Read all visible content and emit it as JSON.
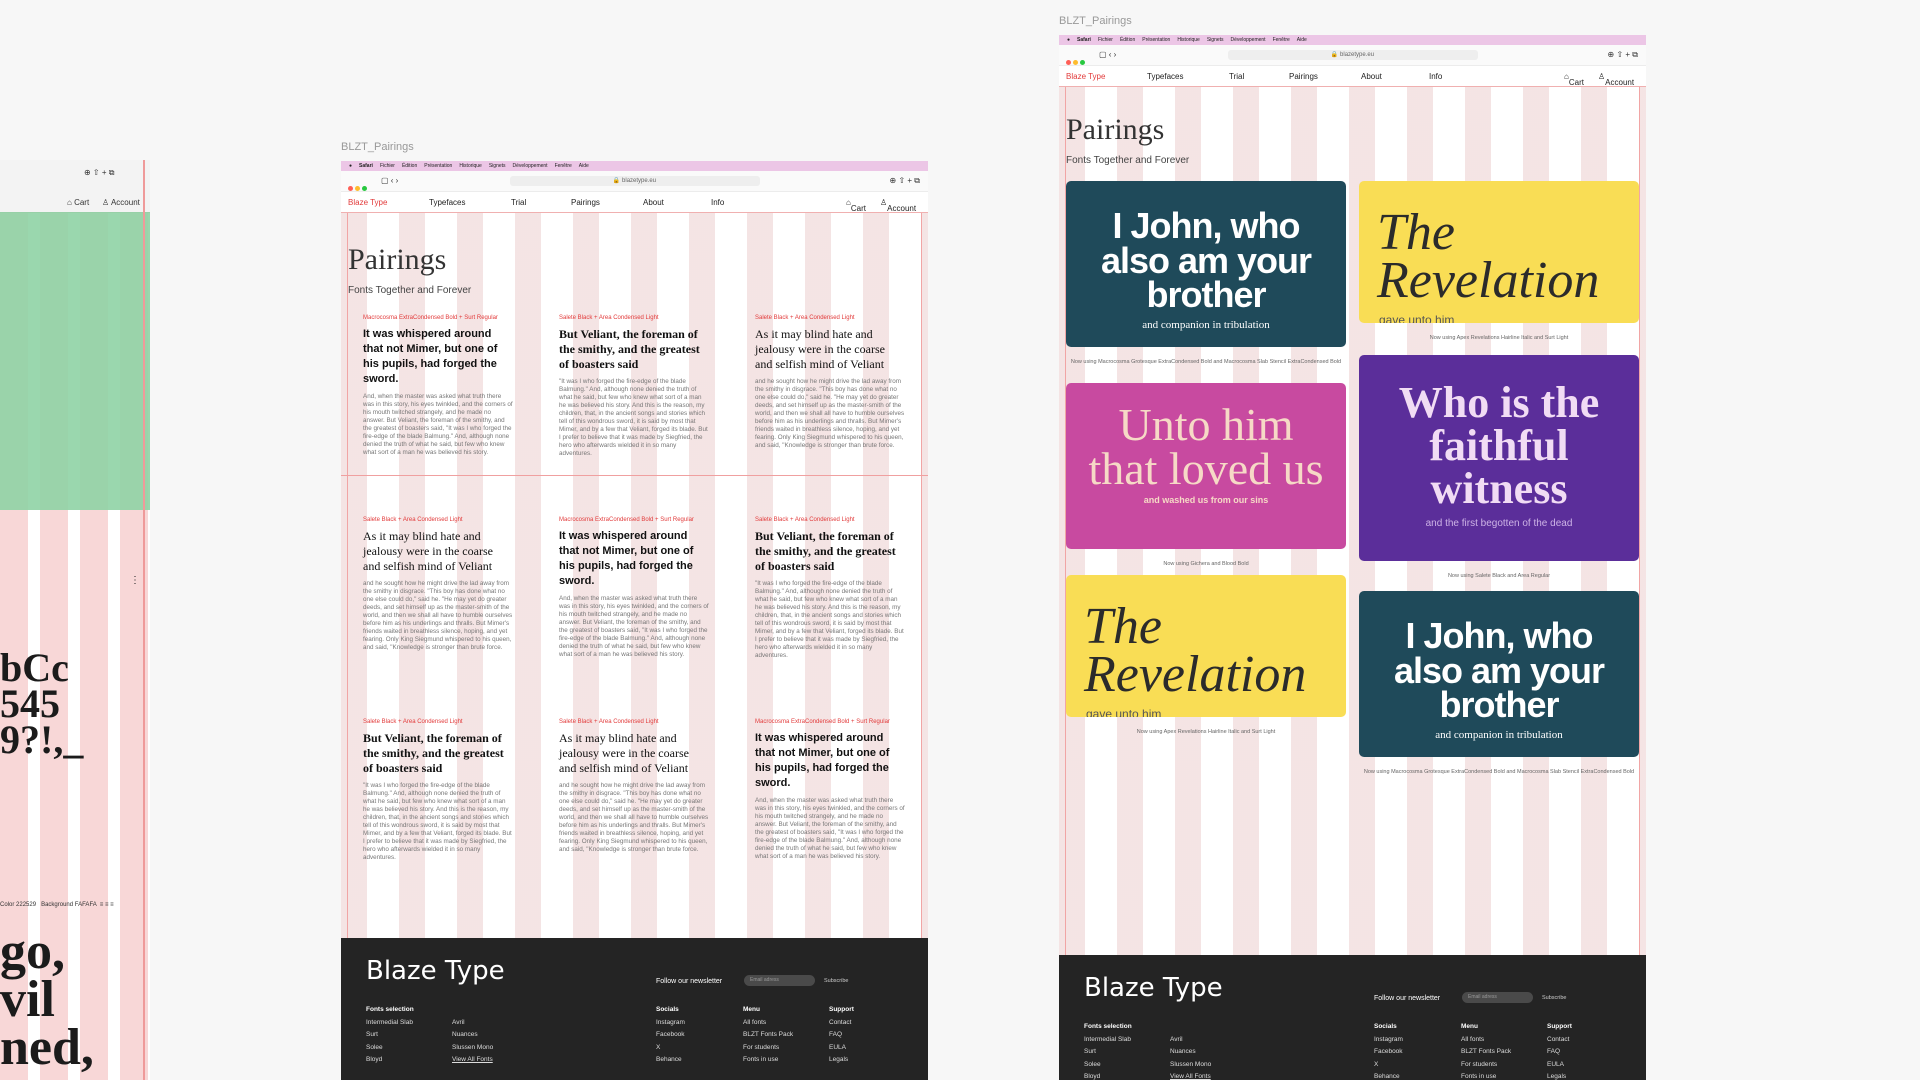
{
  "frames": {
    "middle_label": "BLZT_Pairings",
    "right_label": "BLZT_Pairings"
  },
  "left_frame": {
    "nav": {
      "cart": "Cart",
      "account": "Account"
    },
    "specimen_lines": [
      "bCc",
      "545",
      "9?!,_"
    ],
    "specimen_bottom": [
      "go,",
      "vil",
      "ned,"
    ],
    "color_row": {
      "color_label": "Color",
      "color_value": "222529",
      "bg_label": "Background",
      "bg_value": "FAFAFA"
    }
  },
  "os_menu": [
    "Safari",
    "Fichier",
    "Édition",
    "Présentation",
    "Historique",
    "Signets",
    "Développement",
    "Fenêtre",
    "Aide"
  ],
  "browser": {
    "url": "blazetype.eu"
  },
  "site_nav": {
    "brand": "Blaze Type",
    "items": [
      "Typefaces",
      "Trial",
      "Pairings",
      "About",
      "Info"
    ],
    "cart": "Cart",
    "account": "Account"
  },
  "page": {
    "title": "Pairings",
    "subtitle": "Fonts Together and Forever"
  },
  "text_cards": [
    {
      "meta": "Macrocosma ExtraCondensed Bold + Surt Regular",
      "title": "It was whispered around that not Mimer, but one of his pupils, had forged the sword.",
      "style": "condensed",
      "body": "And, when the master was asked what truth there was in this story, his eyes twinkled, and the corners of his mouth twitched strangely, and he made no answer. But Veliant, the foreman of the smithy, and the greatest of boasters said, \"It was I who forged the fire-edge of the blade Balmung.\" And, although none denied the truth of what he said, but few who knew what sort of a man he was believed his story."
    },
    {
      "meta": "Salete Black + Area Condensed Light",
      "title": "But Veliant, the foreman of the smithy, and the greatest of boasters said",
      "style": "serif-bold",
      "body": "\"It was I who forged the fire-edge of the blade Balmung.\" And, although none denied the truth of what he said, but few who knew what sort of a man he was believed his story. And this is the reason, my children, that, in the ancient songs and stories which tell of this wondrous sword, it is said by most that Mimer, and by a few that Veliant, forged its blade. But I prefer to believe that it was made by Siegfried, the hero who afterwards wielded it in so many adventures."
    },
    {
      "meta": "Salete Black + Area Condensed Light",
      "title": "As it may blind hate and jealousy were in the coarse and selfish mind of Veliant",
      "style": "serif",
      "body": "and he sought how he might drive the lad away from the smithy in disgrace. \"This boy has done what no one else could do,\" said he. \"He may yet do greater deeds, and set himself up as the master-smith of the world, and then we shall all have to humble ourselves before him as his underlings and thralls. But Mimer's friends waited in breathless silence, hoping, and yet fearing. Only King Siegmund whispered to his queen, and said, \"Knowledge is stronger than brute force."
    },
    {
      "meta": "Salete Black + Area Condensed Light",
      "title": "As it may blind hate and jealousy were in the coarse and selfish mind of Veliant",
      "style": "serif",
      "body": "and he sought how he might drive the lad away from the smithy in disgrace. \"This boy has done what no one else could do,\" said he. \"He may yet do greater deeds, and set himself up as the master-smith of the world, and then we shall all have to humble ourselves before him as his underlings and thralls. But Mimer's friends waited in breathless silence, hoping, and yet fearing. Only King Siegmund whispered to his queen, and said, \"Knowledge is stronger than brute force."
    },
    {
      "meta": "Macrocosma ExtraCondensed Bold + Surt Regular",
      "title": "It was whispered around that not Mimer, but one of his pupils, had forged the sword.",
      "style": "condensed",
      "body": "And, when the master was asked what truth there was in this story, his eyes twinkled, and the corners of his mouth twitched strangely, and he made no answer. But Veliant, the foreman of the smithy, and the greatest of boasters said, \"It was I who forged the fire-edge of the blade Balmung.\" And, although none denied the truth of what he said, but few who knew what sort of a man he was believed his story."
    },
    {
      "meta": "Salete Black + Area Condensed Light",
      "title": "But Veliant, the foreman of the smithy, and the greatest of boasters said",
      "style": "serif-bold",
      "body": "\"It was I who forged the fire-edge of the blade Balmung.\" And, although none denied the truth of what he said, but few who knew what sort of a man he was believed his story. And this is the reason, my children, that, in the ancient songs and stories which tell of this wondrous sword, it is said by most that Mimer, and by a few that Veliant, forged its blade. But I prefer to believe that it was made by Siegfried, the hero who afterwards wielded it in so many adventures."
    },
    {
      "meta": "Salete Black + Area Condensed Light",
      "title": "But Veliant, the foreman of the smithy, and the greatest of boasters said",
      "style": "serif-bold",
      "body": "\"It was I who forged the fire-edge of the blade Balmung.\" And, although none denied the truth of what he said, but few who knew what sort of a man he was believed his story. And this is the reason, my children, that, in the ancient songs and stories which tell of this wondrous sword, it is said by most that Mimer, and by a few that Veliant, forged its blade. But I prefer to believe that it was made by Siegfried, the hero who afterwards wielded it in so many adventures."
    },
    {
      "meta": "Salete Black + Area Condensed Light",
      "title": "As it may blind hate and jealousy were in the coarse and selfish mind of Veliant",
      "style": "serif",
      "body": "and he sought how he might drive the lad away from the smithy in disgrace. \"This boy has done what no one else could do,\" said he. \"He may yet do greater deeds, and set himself up as the master-smith of the world, and then we shall all have to humble ourselves before him as his underlings and thralls. But Mimer's friends waited in breathless silence, hoping, and yet fearing. Only King Siegmund whispered to his queen, and said, \"Knowledge is stronger than brute force."
    },
    {
      "meta": "Macrocosma ExtraCondensed Bold + Surt Regular",
      "title": "It was whispered around that not Mimer, but one of his pupils, had forged the sword.",
      "style": "condensed",
      "body": "And, when the master was asked what truth there was in this story, his eyes twinkled, and the corners of his mouth twitched strangely, and he made no answer. But Veliant, the foreman of the smithy, and the greatest of boasters said, \"It was I who forged the fire-edge of the blade Balmung.\" And, although none denied the truth of what he said, but few who knew what sort of a man he was believed his story."
    }
  ],
  "tiles": [
    {
      "title": "I John, who also am your brother",
      "sub": "and companion in tribulation",
      "bg": "#1f4a5a",
      "fg": "#ffffff",
      "caption": "Now using Macrocosma Grotesque ExtraCondensed Bold and Macrocosma Slab Stencil ExtraCondensed Bold"
    },
    {
      "title": "The Revelation",
      "sub": "gave unto him",
      "bg": "#f9dd55",
      "fg": "#2b2b2b",
      "caption": "Now using Apex Revelations Hairline Italic and Surt Light"
    },
    {
      "title": "Unto him that loved us",
      "sub": "and washed us from our sins",
      "bg": "#c84aa0",
      "fg": "#f6d9c6",
      "caption": "Now using Gichera and Blood Bold"
    },
    {
      "title": "Who is the faithful witness",
      "sub": "and the first begotten of the dead",
      "bg": "#5b2e9a",
      "fg": "#f1dcf4",
      "caption": "Now using Salete Black and Area Regular"
    },
    {
      "title": "The Revelation",
      "sub": "gave unto him",
      "bg": "#f9dd55",
      "fg": "#2b2b2b",
      "caption": "Now using Apex Revelations Hairline Italic and Surt Light"
    },
    {
      "title": "I John, who also am your brother",
      "sub": "and companion in tribulation",
      "bg": "#1f4a5a",
      "fg": "#ffffff",
      "caption": "Now using Macrocosma Grotesque ExtraCondensed Bold and Macrocosma Slab Stencil ExtraCondensed Bold"
    }
  ],
  "footer": {
    "brand": "Blaze Type",
    "newsletter_label": "Follow our newsletter",
    "email_placeholder": "Email adress",
    "subscribe": "Subscribe",
    "fonts_heading": "Fonts selection",
    "fonts_col1": [
      "Intermedial Slab",
      "Surt",
      "Solee",
      "Bloyd"
    ],
    "fonts_col2": [
      "Avril",
      "Nuances",
      "Slussen Mono",
      "View All Fonts"
    ],
    "socials_heading": "Socials",
    "socials": [
      "Instagram",
      "Facebook",
      "X",
      "Behance"
    ],
    "menu_heading": "Menu",
    "menu": [
      "All fonts",
      "BLZT Fonts Pack",
      "For students",
      "Fonts in use"
    ],
    "support_heading": "Support",
    "support": [
      "Contact",
      "FAQ",
      "EULA",
      "Legals"
    ]
  }
}
